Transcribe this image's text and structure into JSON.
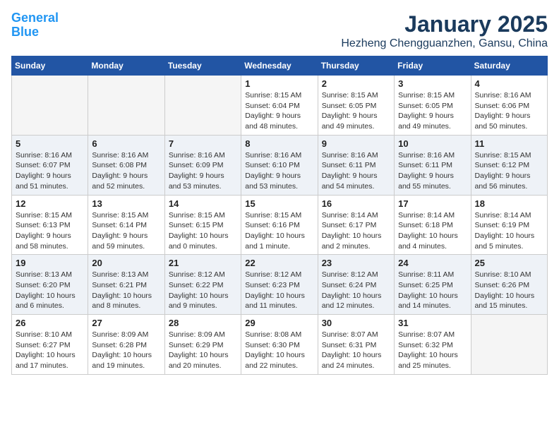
{
  "header": {
    "logo_line1": "General",
    "logo_line2": "Blue",
    "title": "January 2025",
    "subtitle": "Hezheng Chengguanzhen, Gansu, China"
  },
  "weekdays": [
    "Sunday",
    "Monday",
    "Tuesday",
    "Wednesday",
    "Thursday",
    "Friday",
    "Saturday"
  ],
  "weeks": [
    [
      {
        "day": "",
        "info": ""
      },
      {
        "day": "",
        "info": ""
      },
      {
        "day": "",
        "info": ""
      },
      {
        "day": "1",
        "info": "Sunrise: 8:15 AM\nSunset: 6:04 PM\nDaylight: 9 hours\nand 48 minutes."
      },
      {
        "day": "2",
        "info": "Sunrise: 8:15 AM\nSunset: 6:05 PM\nDaylight: 9 hours\nand 49 minutes."
      },
      {
        "day": "3",
        "info": "Sunrise: 8:15 AM\nSunset: 6:05 PM\nDaylight: 9 hours\nand 49 minutes."
      },
      {
        "day": "4",
        "info": "Sunrise: 8:16 AM\nSunset: 6:06 PM\nDaylight: 9 hours\nand 50 minutes."
      }
    ],
    [
      {
        "day": "5",
        "info": "Sunrise: 8:16 AM\nSunset: 6:07 PM\nDaylight: 9 hours\nand 51 minutes."
      },
      {
        "day": "6",
        "info": "Sunrise: 8:16 AM\nSunset: 6:08 PM\nDaylight: 9 hours\nand 52 minutes."
      },
      {
        "day": "7",
        "info": "Sunrise: 8:16 AM\nSunset: 6:09 PM\nDaylight: 9 hours\nand 53 minutes."
      },
      {
        "day": "8",
        "info": "Sunrise: 8:16 AM\nSunset: 6:10 PM\nDaylight: 9 hours\nand 53 minutes."
      },
      {
        "day": "9",
        "info": "Sunrise: 8:16 AM\nSunset: 6:11 PM\nDaylight: 9 hours\nand 54 minutes."
      },
      {
        "day": "10",
        "info": "Sunrise: 8:16 AM\nSunset: 6:11 PM\nDaylight: 9 hours\nand 55 minutes."
      },
      {
        "day": "11",
        "info": "Sunrise: 8:15 AM\nSunset: 6:12 PM\nDaylight: 9 hours\nand 56 minutes."
      }
    ],
    [
      {
        "day": "12",
        "info": "Sunrise: 8:15 AM\nSunset: 6:13 PM\nDaylight: 9 hours\nand 58 minutes."
      },
      {
        "day": "13",
        "info": "Sunrise: 8:15 AM\nSunset: 6:14 PM\nDaylight: 9 hours\nand 59 minutes."
      },
      {
        "day": "14",
        "info": "Sunrise: 8:15 AM\nSunset: 6:15 PM\nDaylight: 10 hours\nand 0 minutes."
      },
      {
        "day": "15",
        "info": "Sunrise: 8:15 AM\nSunset: 6:16 PM\nDaylight: 10 hours\nand 1 minute."
      },
      {
        "day": "16",
        "info": "Sunrise: 8:14 AM\nSunset: 6:17 PM\nDaylight: 10 hours\nand 2 minutes."
      },
      {
        "day": "17",
        "info": "Sunrise: 8:14 AM\nSunset: 6:18 PM\nDaylight: 10 hours\nand 4 minutes."
      },
      {
        "day": "18",
        "info": "Sunrise: 8:14 AM\nSunset: 6:19 PM\nDaylight: 10 hours\nand 5 minutes."
      }
    ],
    [
      {
        "day": "19",
        "info": "Sunrise: 8:13 AM\nSunset: 6:20 PM\nDaylight: 10 hours\nand 6 minutes."
      },
      {
        "day": "20",
        "info": "Sunrise: 8:13 AM\nSunset: 6:21 PM\nDaylight: 10 hours\nand 8 minutes."
      },
      {
        "day": "21",
        "info": "Sunrise: 8:12 AM\nSunset: 6:22 PM\nDaylight: 10 hours\nand 9 minutes."
      },
      {
        "day": "22",
        "info": "Sunrise: 8:12 AM\nSunset: 6:23 PM\nDaylight: 10 hours\nand 11 minutes."
      },
      {
        "day": "23",
        "info": "Sunrise: 8:12 AM\nSunset: 6:24 PM\nDaylight: 10 hours\nand 12 minutes."
      },
      {
        "day": "24",
        "info": "Sunrise: 8:11 AM\nSunset: 6:25 PM\nDaylight: 10 hours\nand 14 minutes."
      },
      {
        "day": "25",
        "info": "Sunrise: 8:10 AM\nSunset: 6:26 PM\nDaylight: 10 hours\nand 15 minutes."
      }
    ],
    [
      {
        "day": "26",
        "info": "Sunrise: 8:10 AM\nSunset: 6:27 PM\nDaylight: 10 hours\nand 17 minutes."
      },
      {
        "day": "27",
        "info": "Sunrise: 8:09 AM\nSunset: 6:28 PM\nDaylight: 10 hours\nand 19 minutes."
      },
      {
        "day": "28",
        "info": "Sunrise: 8:09 AM\nSunset: 6:29 PM\nDaylight: 10 hours\nand 20 minutes."
      },
      {
        "day": "29",
        "info": "Sunrise: 8:08 AM\nSunset: 6:30 PM\nDaylight: 10 hours\nand 22 minutes."
      },
      {
        "day": "30",
        "info": "Sunrise: 8:07 AM\nSunset: 6:31 PM\nDaylight: 10 hours\nand 24 minutes."
      },
      {
        "day": "31",
        "info": "Sunrise: 8:07 AM\nSunset: 6:32 PM\nDaylight: 10 hours\nand 25 minutes."
      },
      {
        "day": "",
        "info": ""
      }
    ]
  ]
}
